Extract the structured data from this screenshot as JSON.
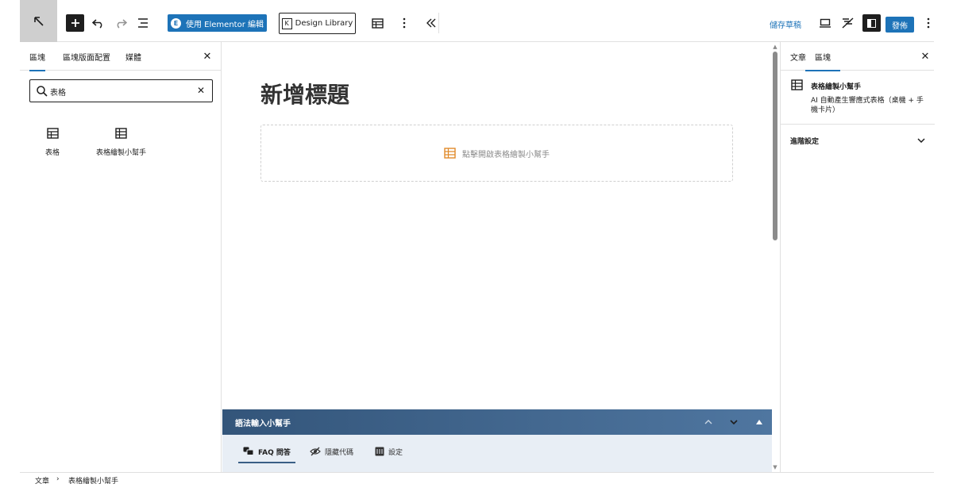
{
  "toolbar": {
    "back_icon": "arrow-up-left-icon",
    "insert_icon": "plus-icon",
    "undo_icon": "undo-icon",
    "redo_icon": "redo-icon",
    "outline_icon": "document-outline-icon",
    "elementor_label": "使用 Elementor 編輯",
    "design_library_label": "Design Library",
    "table_icon": "table-icon",
    "more_icon": "more-vertical-icon",
    "collapse_icon": "chevron-double-left-icon",
    "save_draft_label": "儲存草稿",
    "preview_icon": "desktop-preview-icon",
    "feather_icon": "feather-icon",
    "settings_icon": "sidebar-toggle-icon",
    "publish_label": "發佈",
    "options_icon": "more-vertical-icon"
  },
  "inserter": {
    "tabs": [
      {
        "label": "區塊",
        "active": true
      },
      {
        "label": "區塊版面配置",
        "active": false
      },
      {
        "label": "媒體",
        "active": false
      }
    ],
    "search_value": "表格",
    "results": [
      {
        "label": "表格",
        "icon": "table-icon"
      },
      {
        "label": "表格繪製小幫手",
        "icon": "table-icon"
      }
    ]
  },
  "canvas": {
    "title": "新增標題",
    "placeholder_label": "點擊開啟表格繪製小幫手",
    "placeholder_color": "#e08a2a"
  },
  "helper": {
    "title": "語法輸入小幫手",
    "tabs": [
      {
        "label": "FAQ 問答",
        "icon": "chat-icon",
        "active": true
      },
      {
        "label": "隱藏代碼",
        "icon": "eye-slash-icon",
        "active": false
      },
      {
        "label": "設定",
        "icon": "sliders-icon",
        "active": false
      }
    ]
  },
  "settings": {
    "tabs": [
      {
        "label": "文章",
        "active": false
      },
      {
        "label": "區塊",
        "active": true
      }
    ],
    "block_title": "表格繪製小幫手",
    "block_desc": "AI 自動產生響應式表格（桌機 + 手機卡片）",
    "advanced_label": "進階設定"
  },
  "breadcrumb": {
    "items": [
      "文章",
      "表格繪製小幫手"
    ],
    "separator": "›"
  },
  "colors": {
    "accent": "#1d73b8",
    "helper_header": "#3f6690",
    "helper_body": "#e8eef5"
  }
}
